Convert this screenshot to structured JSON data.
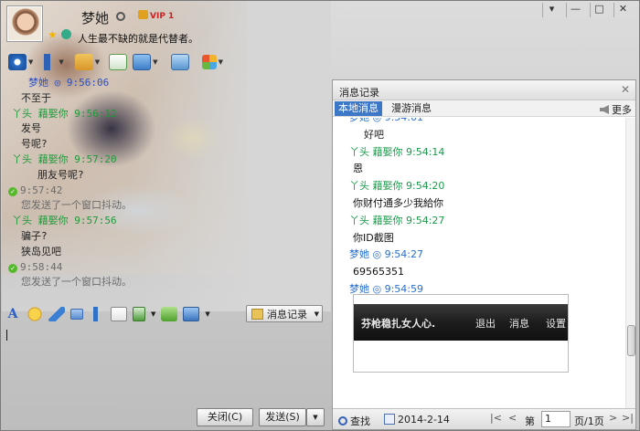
{
  "window": {
    "controls": [
      "▾",
      "—",
      "□",
      "✕"
    ]
  },
  "profile": {
    "name": "梦她",
    "vip": "VIP 1",
    "signature": "人生最不缺的就是代替者。"
  },
  "toolbar_icons": [
    "camera-icon",
    "microphone-icon",
    "folder-icon",
    "file-add-icon",
    "screen-share-icon",
    "photo-icon",
    "apps-icon"
  ],
  "chat": {
    "lines": [
      {
        "kind": "blue",
        "text": "梦她 ◎ 9:56:06"
      },
      {
        "kind": "msg",
        "text": "不至于"
      },
      {
        "kind": "green",
        "text": "丫头  藉娶你  9:56:12"
      },
      {
        "kind": "msg",
        "text": "发号"
      },
      {
        "kind": "msg",
        "text": "号呢?"
      },
      {
        "kind": "green",
        "text": "丫头  藉娶你  9:57:20"
      },
      {
        "kind": "msg2",
        "text": "朋友号呢?"
      },
      {
        "kind": "gray-ok",
        "text": "9:57:42"
      },
      {
        "kind": "gray",
        "text": "您发送了一个窗口抖动。"
      },
      {
        "kind": "green",
        "text": "丫头  藉娶你  9:57:56"
      },
      {
        "kind": "msg",
        "text": "骗子?"
      },
      {
        "kind": "msg",
        "text": "狭岛见吧"
      },
      {
        "kind": "gray-ok",
        "text": "9:58:44"
      },
      {
        "kind": "gray",
        "text": "您发送了一个窗口抖动。"
      }
    ]
  },
  "format_toolbar": {
    "history_button": "消息记录"
  },
  "buttons": {
    "close": "关闭(C)",
    "send": "发送(S)"
  },
  "history": {
    "title": "消息记录",
    "tabs": [
      "本地消息",
      "漫游消息"
    ],
    "more": "更多",
    "entries": [
      {
        "kind": "m",
        "text": "梦她 ◎ 9:54:01"
      },
      {
        "kind": "ind",
        "text": "好吧"
      },
      {
        "kind": "n",
        "text": "丫头  藉娶你  9:54:14"
      },
      {
        "kind": "txt",
        "text": "恩"
      },
      {
        "kind": "n",
        "text": "丫头  藉娶你  9:54:20"
      },
      {
        "kind": "txt",
        "text": "你财付通多少我給你"
      },
      {
        "kind": "n",
        "text": "丫头  藉娶你  9:54:27"
      },
      {
        "kind": "txt",
        "text": "你ID截图"
      },
      {
        "kind": "m",
        "text": "梦她 ◎ 9:54:27"
      },
      {
        "kind": "txt",
        "text": "69565351"
      },
      {
        "kind": "m",
        "text": "梦她 ◎ 9:54:59"
      }
    ],
    "screenshot_nav": [
      "芬枪稳扎女人心.",
      "退出",
      "消息",
      "设置"
    ],
    "footer": {
      "search": "查找",
      "date": "2014-2-14",
      "page_prefix": "第",
      "page_value": "1",
      "page_suffix": "页/1页"
    }
  }
}
